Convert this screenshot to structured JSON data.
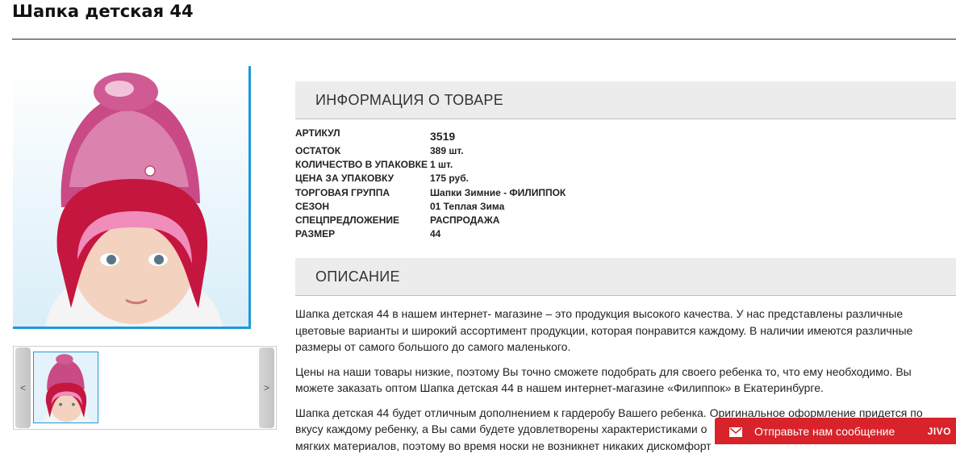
{
  "page": {
    "title": "Шапка детская 44"
  },
  "gallery": {
    "prev_label": "<",
    "next_label": ">"
  },
  "info": {
    "heading": "ИНФОРМАЦИЯ О ТОВАРЕ",
    "rows": [
      {
        "label": "АРТИКУЛ",
        "value": "3519"
      },
      {
        "label": "ОСТАТОК",
        "value": "389 шт."
      },
      {
        "label": "КОЛИЧЕСТВО В УПАКОВКЕ",
        "value": "1 шт."
      },
      {
        "label": "ЦЕНА ЗА УПАКОВКУ",
        "value": "175 руб."
      },
      {
        "label": "ТОРГОВАЯ ГРУППА",
        "value": "Шапки Зимние - ФИЛИППОК"
      },
      {
        "label": "СЕЗОН",
        "value": "01 Теплая Зима"
      },
      {
        "label": "СПЕЦПРЕДЛОЖЕНИЕ",
        "value": "РАСПРОДАЖА"
      },
      {
        "label": "РАЗМЕР",
        "value": "44"
      }
    ]
  },
  "description": {
    "heading": "ОПИСАНИЕ",
    "paragraphs": [
      "Шапка детская 44 в нашем интернет- магазине – это продукция высокого качества. У нас представлены различные цветовые варианты и широкий ассортимент продукции, которая понравится каждому. В наличии имеются различные размеры от самого большого до самого маленького.",
      "Цены на наши товары низкие, поэтому Вы точно сможете подобрать для своего ребенка то, что ему необходимо. Вы можете заказать оптом Шапка детская 44 в нашем интернет-магазине «Филиппок» в Екатеринбурге.",
      "Шапка детская 44 будет отличным дополнением к гардеробу Вашего ребенка. Оригинальное оформление придется по вкусу каждому ребенку, а Вы сами будете удовлетворены характеристиками о",
      "мягких материалов, поэтому во время носки не возникнет никаких дискомфорт"
    ]
  },
  "chat": {
    "label": "Отправьте нам сообщение",
    "brand": "JIVO"
  },
  "colors": {
    "accent_blue": "#1b9ad6",
    "chat_red": "#d8232a",
    "section_bg": "#ececec"
  }
}
